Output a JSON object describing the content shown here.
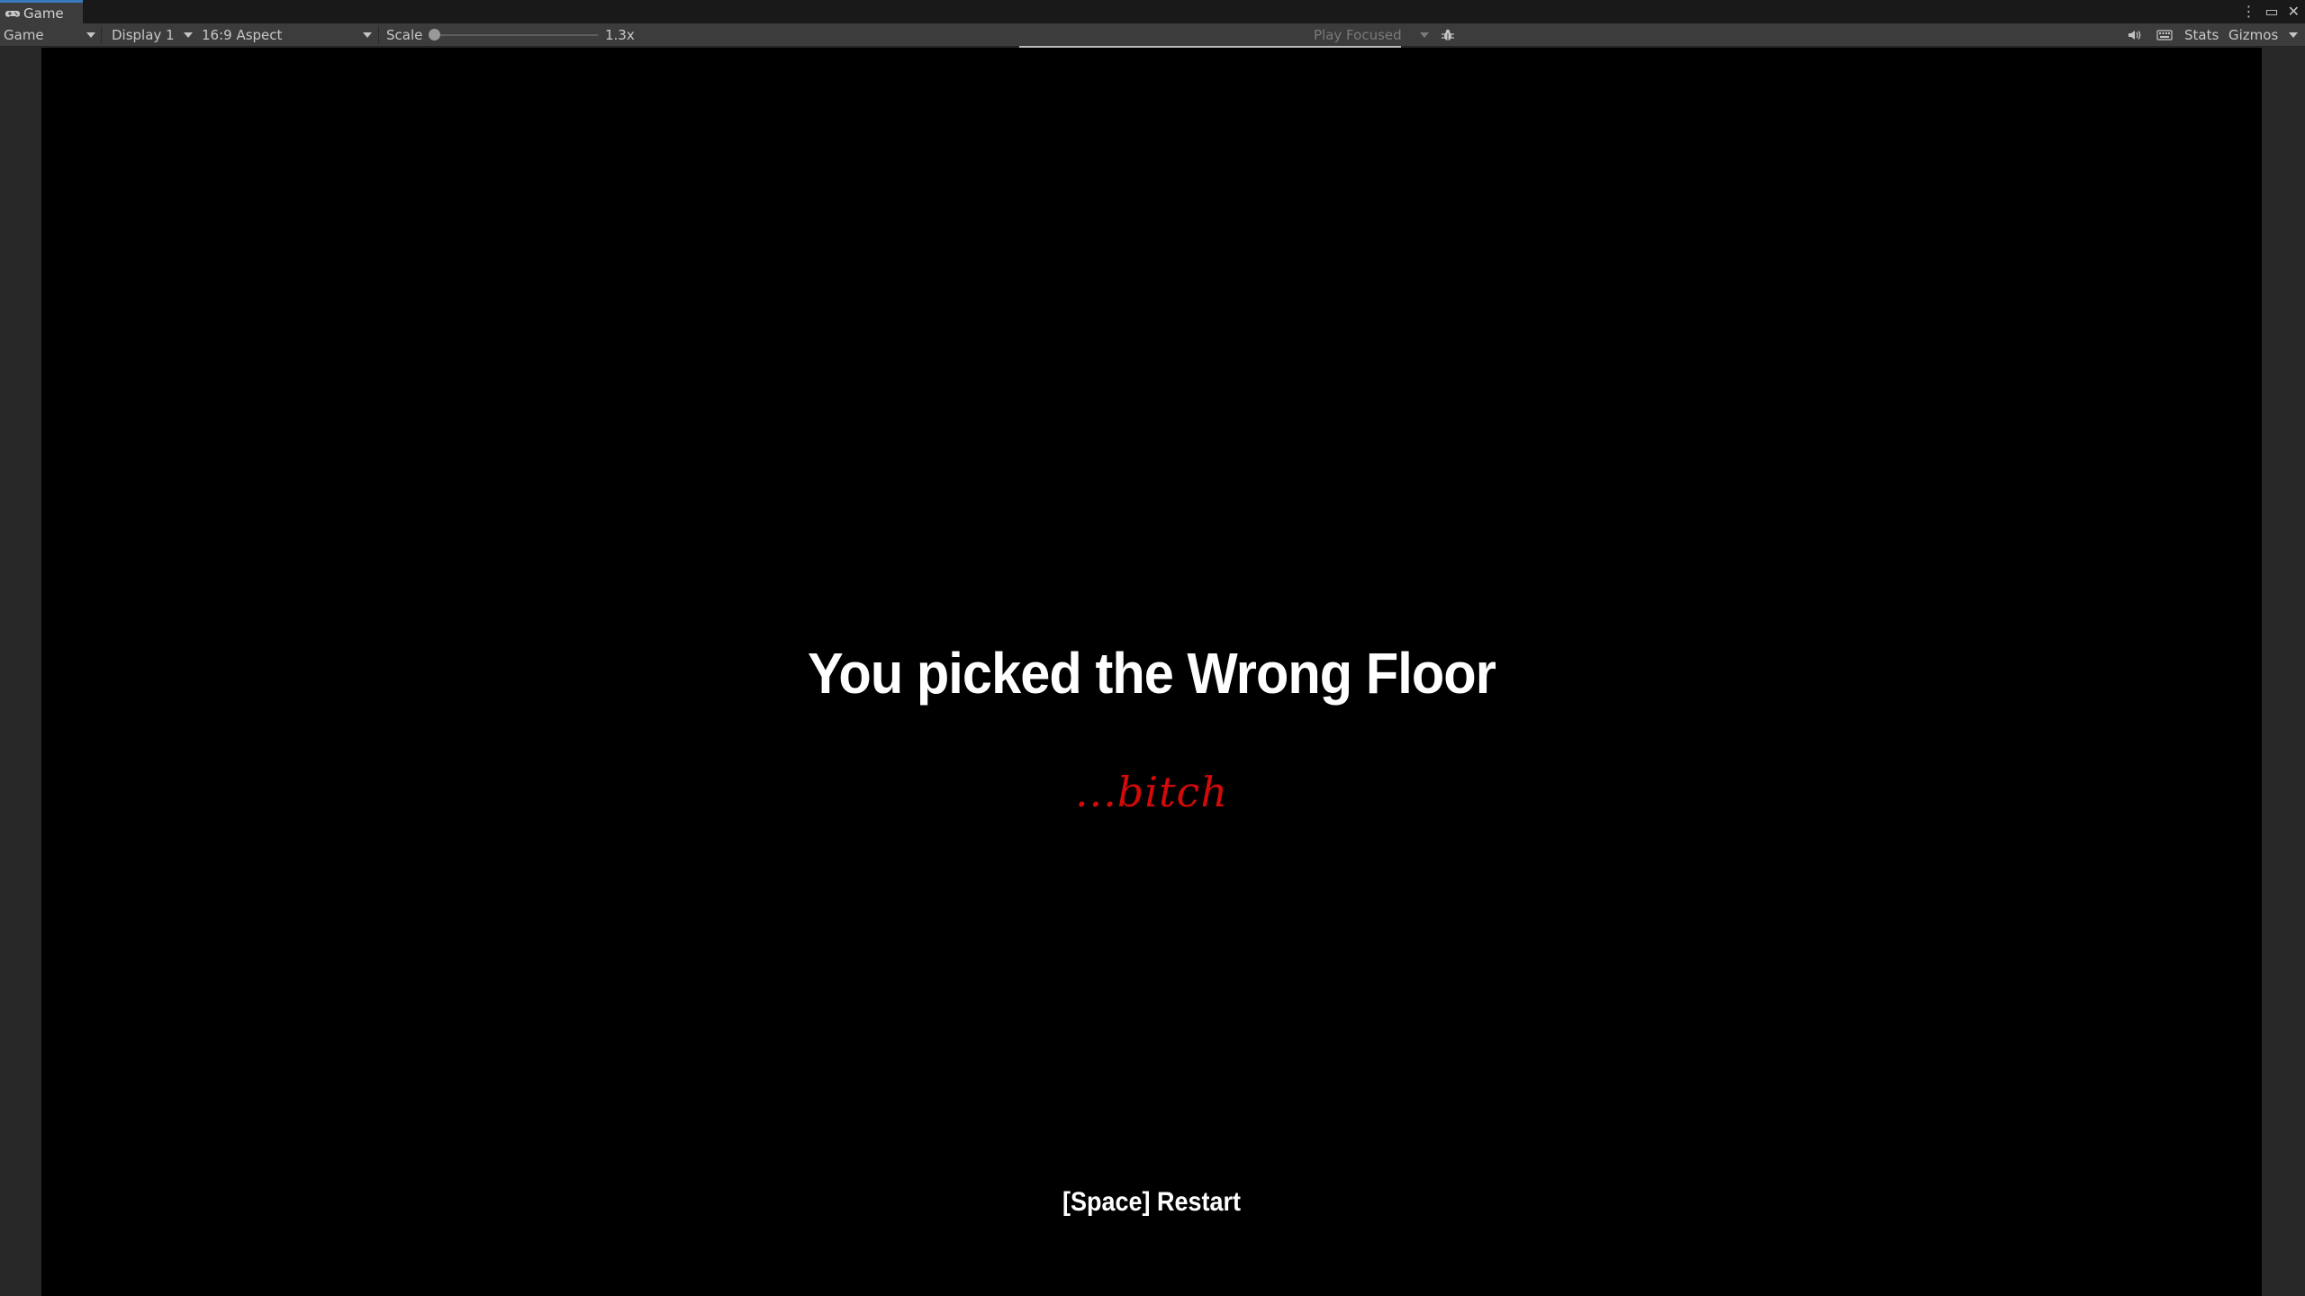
{
  "window": {
    "tab_label": "Game"
  },
  "toolbar": {
    "view_mode": "Game",
    "display": "Display 1",
    "aspect": "16:9 Aspect",
    "scale_label": "Scale",
    "scale_value": "1.3x",
    "play_mode": "Play Focused",
    "stats_label": "Stats",
    "gizmos_label": "Gizmos"
  },
  "game": {
    "headline": "You picked the Wrong Floor",
    "subline": "...bitch",
    "restart_hint": "[Space] Restart"
  },
  "colors": {
    "viewport_background": "#000000",
    "headline_text": "#ffffff",
    "subline_text": "#d20a0a",
    "tab_accent": "#3a79bb"
  }
}
